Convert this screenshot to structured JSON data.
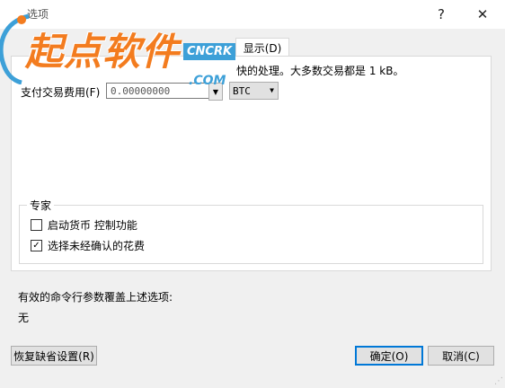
{
  "window": {
    "title": "选项",
    "help_glyph": "?",
    "close_glyph": "✕"
  },
  "watermark": {
    "brand_text": "起点软件",
    "badge": "CNCRK",
    "com": ".COM"
  },
  "tabs": [
    {
      "label": "显示(D)",
      "active": true
    }
  ],
  "panel": {
    "description": "快的处理。大多数交易都是 1 kB。",
    "fee_label": "支付交易费用(F)",
    "fee_value": "0.00000000",
    "fee_unit": "BTC",
    "expert": {
      "title": "专家",
      "options": [
        {
          "label": "启动货币 控制功能",
          "checked": false
        },
        {
          "label": "选择未经确认的花费",
          "checked": true
        }
      ]
    }
  },
  "override": {
    "label": "有效的命令行参数覆盖上述选项:",
    "value": "无"
  },
  "buttons": {
    "reset": "恢复缺省设置(R)",
    "ok": "确定(O)",
    "cancel": "取消(C)"
  },
  "colors": {
    "brand_orange": "#f37c1f",
    "brand_blue": "#3da0d8",
    "focus_blue": "#0078d7"
  }
}
